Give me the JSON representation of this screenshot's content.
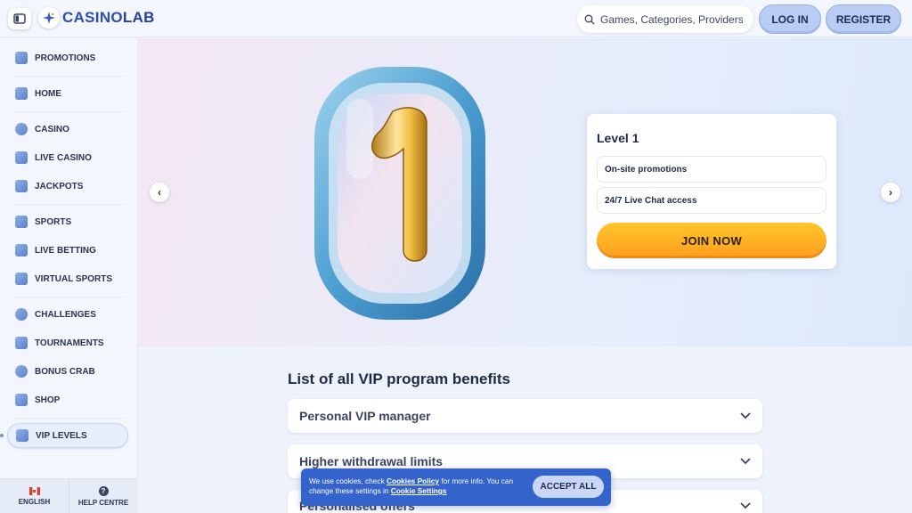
{
  "header": {
    "brand_left": "CASINO",
    "brand_right": "LAB",
    "search_placeholder": "Games, Categories, Providers",
    "login_label": "LOG IN",
    "register_label": "REGISTER"
  },
  "sidebar": {
    "items": [
      {
        "label": "PROMOTIONS",
        "icon": "megaphone-icon"
      },
      {
        "label": "HOME",
        "icon": "home-icon"
      },
      {
        "label": "CASINO",
        "icon": "chip-icon"
      },
      {
        "label": "LIVE CASINO",
        "icon": "live-casino-icon"
      },
      {
        "label": "JACKPOTS",
        "icon": "jackpot-icon"
      },
      {
        "label": "SPORTS",
        "icon": "sports-icon"
      },
      {
        "label": "LIVE BETTING",
        "icon": "live-betting-icon"
      },
      {
        "label": "VIRTUAL SPORTS",
        "icon": "virtual-sports-icon"
      },
      {
        "label": "CHALLENGES",
        "icon": "challenges-icon"
      },
      {
        "label": "TOURNAMENTS",
        "icon": "trophy-icon"
      },
      {
        "label": "BONUS CRAB",
        "icon": "crab-icon"
      },
      {
        "label": "SHOP",
        "icon": "shop-icon"
      },
      {
        "label": "VIP LEVELS",
        "icon": "crown-icon",
        "active": true
      }
    ],
    "footer": {
      "language_label": "ENGLISH",
      "help_label": "HELP CENTRE"
    }
  },
  "hero": {
    "badge_number": "1",
    "level_title": "Level 1",
    "benefits": [
      "On-site promotions",
      "24/7 Live Chat access"
    ],
    "join_label": "JOIN NOW"
  },
  "benefits_section": {
    "title": "List of all VIP program benefits",
    "items": [
      "Personal VIP manager",
      "Higher withdrawal limits",
      "Personalised offers"
    ]
  },
  "cookie_banner": {
    "text_1": "We use cookies, check ",
    "link_1": "Cookies Policy",
    "text_2": " for more info. You can change these settings in ",
    "link_2": "Cookie Settings",
    "accept_label": "ACCEPT ALL"
  },
  "colors": {
    "accent": "#3563cc",
    "join_button": "#ffb422",
    "brand": "#2d4fb0"
  }
}
